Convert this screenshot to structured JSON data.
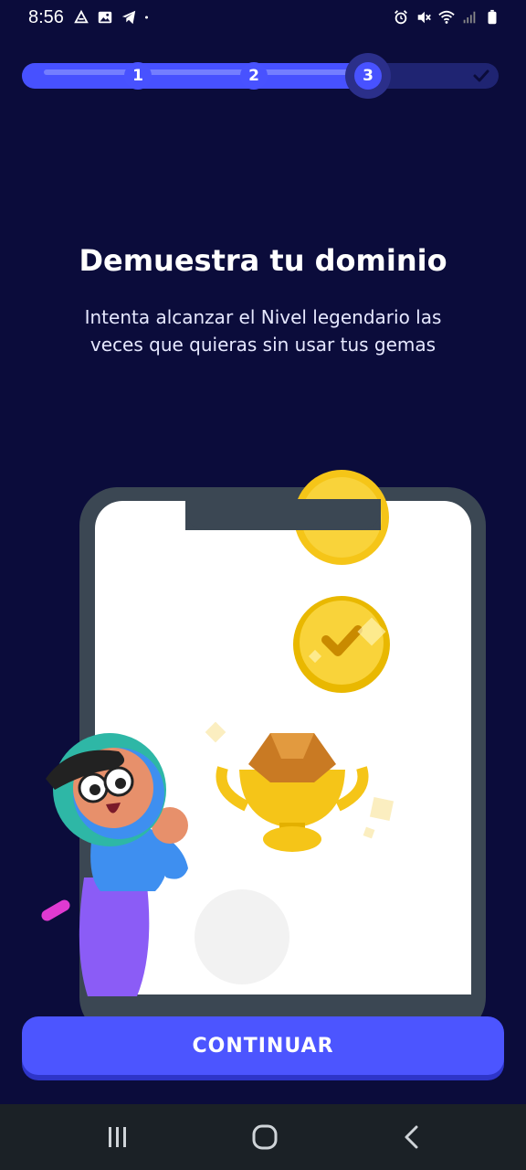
{
  "status_bar": {
    "time": "8:56",
    "left_icons": [
      "drive-icon",
      "gallery-icon",
      "telegram-icon",
      "dot-icon"
    ],
    "right_icons": [
      "alarm-icon",
      "mute-icon",
      "wifi-icon",
      "signal-icon",
      "battery-icon"
    ]
  },
  "progress": {
    "steps": [
      "1",
      "2",
      "3"
    ],
    "current_step": 3,
    "final_icon": "check-icon"
  },
  "content": {
    "title": "Demuestra tu dominio",
    "subtitle": "Intenta alcanzar el Nivel legendario las veces que quieras sin usar tus gemas"
  },
  "illustration": {
    "icons": [
      "coin-icon",
      "check-coin-icon",
      "trophy-icon",
      "character-icon"
    ]
  },
  "actions": {
    "continue_label": "CONTINUAR"
  },
  "nav_bar": {
    "icons": [
      "recent-apps-icon",
      "home-icon",
      "back-icon"
    ]
  },
  "colors": {
    "background": "#0b0c3b",
    "accent": "#4c55ff",
    "phone_frame": "#3b4753",
    "gold": "#f5c518"
  }
}
